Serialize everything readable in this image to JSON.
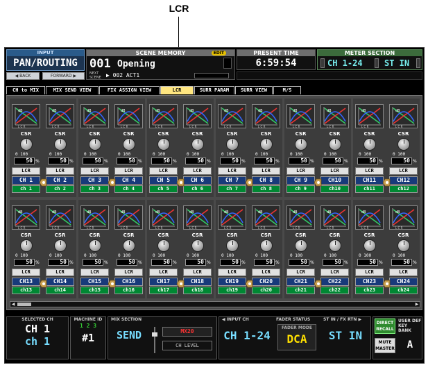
{
  "callout": {
    "label": "LCR"
  },
  "header": {
    "input_label": "INPUT",
    "input_title": "PAN/ROUTING",
    "back_label": "◀ BACK",
    "forward_label": "FORWARD ▶",
    "scene_memory_label": "SCENE MEMORY",
    "edit_badge": "EDIT",
    "scene_number": "001",
    "scene_name": "Opening",
    "next_scene_label": "NEXT SCENE",
    "next_scene": "▶ 002 ACT1",
    "present_time_label": "PRESENT TIME",
    "present_time": "6:59:54",
    "meter_section_label": "METER SECTION",
    "meter_ch_range": "CH 1-24",
    "meter_st": "ST IN"
  },
  "tabs": [
    {
      "label": "CH to MIX",
      "active": false
    },
    {
      "label": "MIX SEND VIEW",
      "active": false
    },
    {
      "label": "FIX ASSIGN VIEW",
      "active": false
    },
    {
      "label": "LCR",
      "active": true
    },
    {
      "label": "SURR PARAM",
      "active": false
    },
    {
      "label": "SURR VIEW",
      "active": false
    },
    {
      "label": "M/S",
      "active": false
    }
  ],
  "strip_common": {
    "csr_label": "CSR",
    "scale_label": "0 100",
    "csr_value": "50",
    "percent": "%",
    "lcr_button": "LCR"
  },
  "channels_row1": [
    {
      "id": "CH 1",
      "name": "ch 1"
    },
    {
      "id": "CH 2",
      "name": "ch 2"
    },
    {
      "id": "CH 3",
      "name": "ch 3"
    },
    {
      "id": "CH 4",
      "name": "ch 4"
    },
    {
      "id": "CH 5",
      "name": "ch 5"
    },
    {
      "id": "CH 6",
      "name": "ch 6"
    },
    {
      "id": "CH 7",
      "name": "ch 7"
    },
    {
      "id": "CH 8",
      "name": "ch 8"
    },
    {
      "id": "CH 9",
      "name": "ch 9"
    },
    {
      "id": "CH10",
      "name": "ch10"
    },
    {
      "id": "CH11",
      "name": "ch11"
    },
    {
      "id": "CH12",
      "name": "ch12"
    }
  ],
  "channels_row2": [
    {
      "id": "CH13",
      "name": "ch13"
    },
    {
      "id": "CH14",
      "name": "ch14"
    },
    {
      "id": "CH15",
      "name": "ch15"
    },
    {
      "id": "CH16",
      "name": "ch16"
    },
    {
      "id": "CH17",
      "name": "ch17"
    },
    {
      "id": "CH18",
      "name": "ch18"
    },
    {
      "id": "CH19",
      "name": "ch19"
    },
    {
      "id": "CH20",
      "name": "ch20"
    },
    {
      "id": "CH21",
      "name": "ch21"
    },
    {
      "id": "CH22",
      "name": "ch22"
    },
    {
      "id": "CH23",
      "name": "ch23"
    },
    {
      "id": "CH24",
      "name": "ch24"
    }
  ],
  "footer": {
    "selected_ch_label": "SELECTED CH",
    "selected_ch": "CH 1",
    "selected_ch_name": "ch 1",
    "machine_id_label": "MACHINE ID",
    "machine_digits": "1 2 3",
    "machine_id": "#1",
    "mix_section_label": "MIX SECTION",
    "mix_send": "SEND",
    "mix_bus": "MX20",
    "ch_level": "CH LEVEL",
    "input_ch_label": "◀ INPUT CH",
    "fader_status_label": "FADER STATUS",
    "st_in_label": "ST IN / FX RTN ▶",
    "input_ch": "CH 1-24",
    "fader_mode_label": "FADER MODE",
    "fader_mode": "DCA",
    "st_in": "ST IN",
    "direct_recall": "DIRECT RECALL",
    "user_def_label": "USER DEF KEY BANK",
    "mute_master": "MUTE MASTER",
    "key_bank": "A"
  },
  "colors": {
    "tab_active": "#ffe680",
    "channel_id_bg": "#183a7a",
    "channel_name_bg": "#008833",
    "value_cyan": "#77ddff",
    "dca_yellow": "#ffe000"
  },
  "icons": [
    "lcr-graph-icon",
    "stereo-link-icon",
    "knob-icon"
  ]
}
